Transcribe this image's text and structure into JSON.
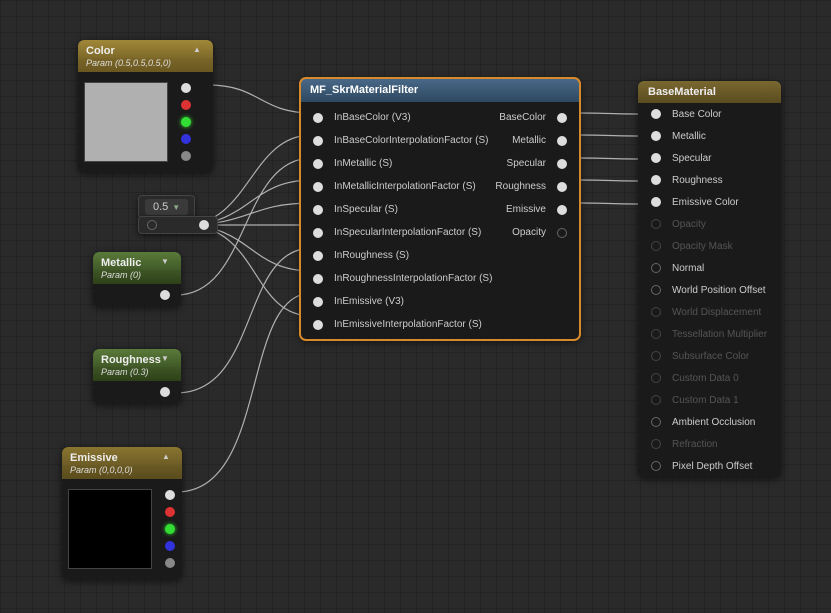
{
  "nodes": {
    "color": {
      "title": "Color",
      "subtitle": "Param (0.5,0.5,0.5,0)"
    },
    "metallic": {
      "title": "Metallic",
      "subtitle": "Param (0)"
    },
    "roughness": {
      "title": "Roughness",
      "subtitle": "Param (0.3)"
    },
    "emissive": {
      "title": "Emissive",
      "subtitle": "Param (0,0,0,0)"
    },
    "constant": {
      "value": "0.5"
    }
  },
  "mf": {
    "title": "MF_SkrMaterialFilter",
    "inputs": [
      "InBaseColor (V3)",
      "InBaseColorInterpolationFactor (S)",
      "InMetallic (S)",
      "InMetallicInterpolationFactor (S)",
      "InSpecular (S)",
      "InSpecularInterpolationFactor (S)",
      "InRoughness (S)",
      "InRoughnessInterpolationFactor (S)",
      "InEmissive (V3)",
      "InEmissiveInterpolationFactor (S)"
    ],
    "outputs": [
      "BaseColor",
      "Metallic",
      "Specular",
      "Roughness",
      "Emissive",
      "Opacity"
    ]
  },
  "result": {
    "title": "BaseMaterial",
    "pins": [
      {
        "label": "Base Color",
        "enabled": true
      },
      {
        "label": "Metallic",
        "enabled": true
      },
      {
        "label": "Specular",
        "enabled": true
      },
      {
        "label": "Roughness",
        "enabled": true
      },
      {
        "label": "Emissive Color",
        "enabled": true
      },
      {
        "label": "Opacity",
        "enabled": false
      },
      {
        "label": "Opacity Mask",
        "enabled": false
      },
      {
        "label": "Normal",
        "enabled": true
      },
      {
        "label": "World Position Offset",
        "enabled": true
      },
      {
        "label": "World Displacement",
        "enabled": false
      },
      {
        "label": "Tessellation Multiplier",
        "enabled": false
      },
      {
        "label": "Subsurface Color",
        "enabled": false
      },
      {
        "label": "Custom Data 0",
        "enabled": false
      },
      {
        "label": "Custom Data 1",
        "enabled": false
      },
      {
        "label": "Ambient Occlusion",
        "enabled": true
      },
      {
        "label": "Refraction",
        "enabled": false
      },
      {
        "label": "Pixel Depth Offset",
        "enabled": true
      }
    ]
  },
  "colors": {
    "wire": "#b0b0b0",
    "selected_outline": "#d88a2a"
  }
}
